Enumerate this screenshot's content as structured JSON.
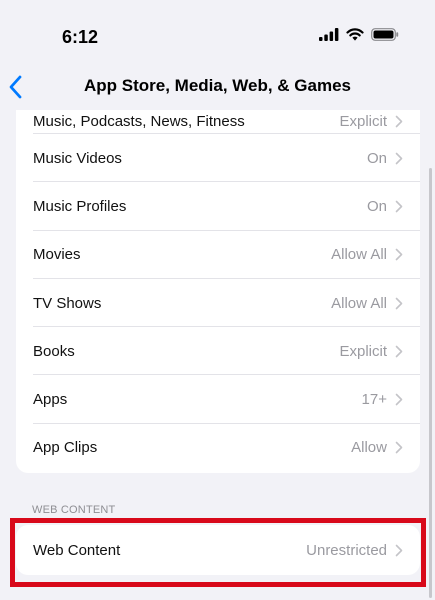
{
  "status_bar": {
    "time": "6:12",
    "icons": [
      "signal-bars-icon",
      "wifi-icon",
      "battery-icon"
    ]
  },
  "nav": {
    "back_icon": "chevron-left-icon",
    "title": "App Store, Media, Web, & Games"
  },
  "settings": {
    "partial_row": {
      "label": "Music, Podcasts, News, Fitness",
      "value": "Explicit"
    },
    "rows": [
      {
        "label": "Music Videos",
        "value": "On"
      },
      {
        "label": "Music Profiles",
        "value": "On"
      },
      {
        "label": "Movies",
        "value": "Allow All"
      },
      {
        "label": "TV Shows",
        "value": "Allow All"
      },
      {
        "label": "Books",
        "value": "Explicit"
      },
      {
        "label": "Apps",
        "value": "17+"
      },
      {
        "label": "App Clips",
        "value": "Allow"
      }
    ]
  },
  "web_content": {
    "section_header": "WEB CONTENT",
    "row": {
      "label": "Web Content",
      "value": "Unrestricted"
    }
  },
  "colors": {
    "accent": "#007aff",
    "highlight": "#d8091a",
    "background": "#f2f2f7",
    "secondary_text": "#9a9aa0"
  }
}
